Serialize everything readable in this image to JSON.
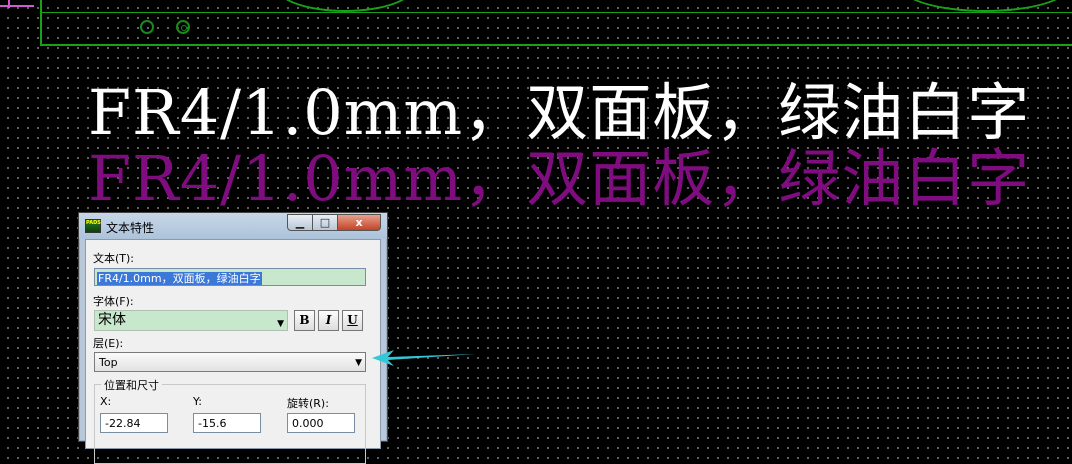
{
  "canvas": {
    "text_line_1": "FR4/1.0mm，双面板，绿油白字",
    "text_line_2": "FR4/1.0mm，双面板，绿油白字",
    "colors": {
      "background": "#000000",
      "outline": "#18a018",
      "selected_text": "#ffffff",
      "ghost_text": "#7f0d7f",
      "arrow": "#32c8d8"
    }
  },
  "dialog": {
    "icon_text": "PADS",
    "title": "文本特性",
    "buttons": {
      "minimize": "▁",
      "maximize": "□",
      "close": "x"
    },
    "text_label": "文本(T):",
    "text_value": "FR4/1.0mm，双面板，绿油白字",
    "font_label": "字体(F):",
    "font_value": "宋体",
    "bold_label": "B",
    "italic_label": "I",
    "underline_label": "U",
    "layer_label": "层(E):",
    "layer_value": "Top",
    "position_group": "位置和尺寸",
    "x_label": "X:",
    "x_value": "-22.84",
    "y_label": "Y:",
    "y_value": "-15.6",
    "rotation_label": "旋转(R):",
    "rotation_value": "0.000"
  }
}
